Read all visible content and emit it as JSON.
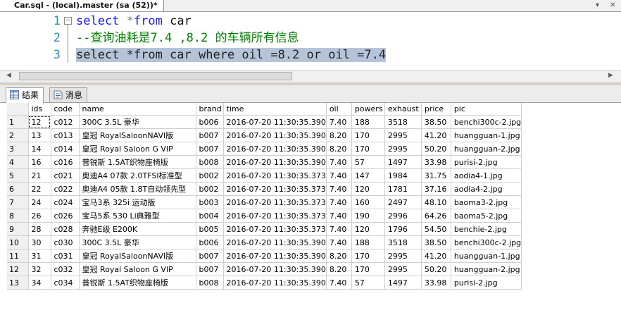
{
  "window": {
    "doc_tab_title": "Car.sql - (local).master (sa (52))*",
    "win_buttons": [
      "▾",
      "✕"
    ]
  },
  "editor": {
    "lines": [
      {
        "num": "1",
        "tokens": [
          [
            "kw",
            "select"
          ],
          [
            "op",
            " *"
          ],
          [
            "kw",
            "from"
          ],
          [
            "id",
            " car"
          ]
        ]
      },
      {
        "num": "2",
        "tokens": [
          [
            "cmt",
            "--查询油耗是7.4 ,8.2 的车辆所有信息"
          ]
        ]
      },
      {
        "num": "3",
        "tokens": [
          [
            "sel",
            "select *from car where oil =8.2 or oil =7.4"
          ]
        ]
      }
    ]
  },
  "result_tabs": [
    {
      "label": "结果",
      "icon": "grid-icon",
      "active": true
    },
    {
      "label": "消息",
      "icon": "messages-icon",
      "active": false
    }
  ],
  "grid": {
    "columns": [
      "ids",
      "code",
      "name",
      "brand",
      "time",
      "oil",
      "powers",
      "exhaust",
      "price",
      "pic"
    ],
    "rows": [
      [
        "1",
        "12",
        "c012",
        "300C 3.5L 豪华",
        "b006",
        "2016-07-20 11:30:35.390",
        "7.40",
        "188",
        "3518",
        "38.50",
        "benchi300c-2.jpg"
      ],
      [
        "2",
        "13",
        "c013",
        "皇冠 RoyalSaloonNAVI版",
        "b007",
        "2016-07-20 11:30:35.390",
        "8.20",
        "170",
        "2995",
        "41.20",
        "huangguan-1.jpg"
      ],
      [
        "3",
        "14",
        "c014",
        "皇冠 Royal Saloon G VIP",
        "b007",
        "2016-07-20 11:30:35.390",
        "8.20",
        "170",
        "2995",
        "50.20",
        "huangguan-2.jpg"
      ],
      [
        "4",
        "16",
        "c016",
        "普锐斯 1.5AT织物座椅版",
        "b008",
        "2016-07-20 11:30:35.390",
        "7.40",
        "57",
        "1497",
        "33.98",
        "purisi-2.jpg"
      ],
      [
        "5",
        "21",
        "c021",
        "奥迪A4 07款 2.0TFSI标准型",
        "b002",
        "2016-07-20 11:30:35.373",
        "7.40",
        "147",
        "1984",
        "31.75",
        "aodia4-1.jpg"
      ],
      [
        "6",
        "22",
        "c022",
        "奥迪A4 05款 1.8T自动领先型",
        "b002",
        "2016-07-20 11:30:35.373",
        "7.40",
        "120",
        "1781",
        "37.16",
        "aodia4-2.jpg"
      ],
      [
        "7",
        "24",
        "c024",
        "宝马3系 325i 运动版",
        "b003",
        "2016-07-20 11:30:35.373",
        "7.40",
        "160",
        "2497",
        "48.10",
        "baoma3-2.jpg"
      ],
      [
        "8",
        "26",
        "c026",
        "宝马5系 530 Li典雅型",
        "b004",
        "2016-07-20 11:30:35.373",
        "7.40",
        "190",
        "2996",
        "64.26",
        "baoma5-2.jpg"
      ],
      [
        "9",
        "28",
        "c028",
        "奔驰E级 E200K",
        "b005",
        "2016-07-20 11:30:35.373",
        "7.40",
        "120",
        "1796",
        "54.50",
        "benchie-2.jpg"
      ],
      [
        "10",
        "30",
        "c030",
        "300C 3.5L 豪华",
        "b006",
        "2016-07-20 11:30:35.390",
        "7.40",
        "188",
        "3518",
        "38.50",
        "benchi300c-2.jpg"
      ],
      [
        "11",
        "31",
        "c031",
        "皇冠 RoyalSaloonNAVI版",
        "b007",
        "2016-07-20 11:30:35.390",
        "8.20",
        "170",
        "2995",
        "41.20",
        "huangguan-1.jpg"
      ],
      [
        "12",
        "32",
        "c032",
        "皇冠 Royal Saloon G VIP",
        "b007",
        "2016-07-20 11:30:35.390",
        "8.20",
        "170",
        "2995",
        "50.20",
        "huangguan-2.jpg"
      ],
      [
        "13",
        "34",
        "c034",
        "普锐斯 1.5AT织物座椅版",
        "b008",
        "2016-07-20 11:30:35.390",
        "7.40",
        "57",
        "1497",
        "33.98",
        "purisi-2.jpg"
      ]
    ]
  },
  "colors": {
    "keyword": "#1a1aff",
    "comment": "#008000",
    "line_number": "#2b91af",
    "selection": "#b5c4d8"
  }
}
